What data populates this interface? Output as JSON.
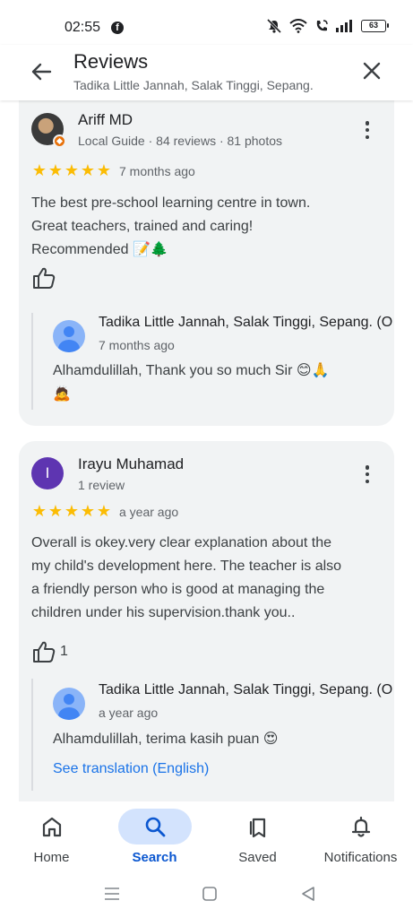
{
  "status_bar": {
    "time": "02:55",
    "battery": "63"
  },
  "header": {
    "title": "Reviews",
    "subtitle": "Tadika Little Jannah, Salak Tinggi, Sepang."
  },
  "reviews": [
    {
      "name": "Ariff MD",
      "meta": "Local Guide · 84 reviews · 81 photos",
      "rating": 5,
      "time": "7 months ago",
      "text_lines": [
        "The best pre-school learning centre in town.",
        "Great teachers, trained and caring!",
        "Recommended 📝🌲"
      ],
      "likes": "",
      "reply": {
        "owner": "Tadika Little Jannah, Salak Tinggi, Sepang. (O",
        "time": "7 months ago",
        "text_lines": [
          "Alhamdulillah, Thank you so much Sir 😊🙏",
          "🙇"
        ]
      }
    },
    {
      "name": "Irayu Muhamad",
      "avatar_letter": "I",
      "meta": "1 review",
      "rating": 5,
      "time": "a year ago",
      "text_lines": [
        "Overall is okey.very clear explanation about the",
        "my child's development here. The teacher is also",
        "a friendly person who is good at managing the",
        "children under his supervision.thank you.."
      ],
      "likes": "1",
      "reply": {
        "owner": "Tadika Little Jannah, Salak Tinggi, Sepang. (O",
        "time": "a year ago",
        "text_lines": [
          "Alhamdulillah, terima kasih puan 😍"
        ],
        "translate": "See translation (English)"
      }
    }
  ],
  "bottom_nav": {
    "items": [
      {
        "label": "Home",
        "icon": "home-icon",
        "active": false
      },
      {
        "label": "Search",
        "icon": "search-icon",
        "active": true
      },
      {
        "label": "Saved",
        "icon": "saved-icon",
        "active": false
      },
      {
        "label": "Notifications",
        "icon": "bell-icon",
        "active": false
      }
    ]
  },
  "colors": {
    "accent": "#0b57d0",
    "star": "#fbbc04",
    "link": "#1a73e8",
    "card_bg": "#f1f3f4"
  }
}
